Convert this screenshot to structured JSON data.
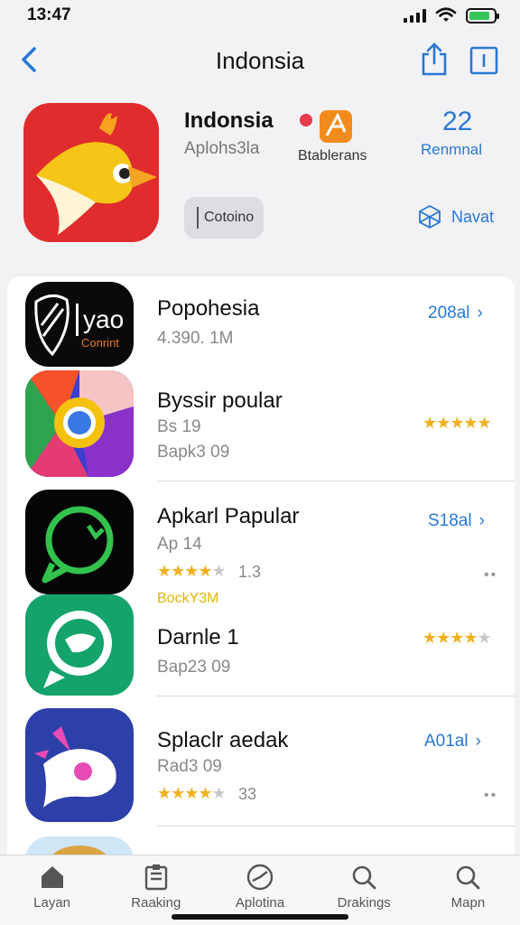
{
  "status": {
    "time": "13:47"
  },
  "nav": {
    "title": "Indonsia"
  },
  "header": {
    "app_name": "Indonsia",
    "app_subtitle": "Aplohs3la",
    "category_label": "Btablerans",
    "rank_number": "22",
    "rank_label": "Renmnal",
    "get_button": "Cotoino",
    "navigate_label": "Navat"
  },
  "list": [
    {
      "title": "Popohesia",
      "sub": "4.390. 1M",
      "action": "208al",
      "logo_text": "yao",
      "logo_sub": "Conrint"
    },
    {
      "title": "Byssir poular",
      "sub": "Bs 19",
      "sub2": "Bapk3 09",
      "stars": 5
    },
    {
      "title": "Apkarl Papular",
      "sub": "Ap 14",
      "rating_count": "1.3",
      "badge": "BockY3M",
      "action": "S18al",
      "stars": 4
    },
    {
      "title": "Darnle 1",
      "sub": "Bap23 09",
      "stars": 4
    },
    {
      "title": "Splaclr aedak",
      "sub": "Rad3 09",
      "rating_count": "33",
      "action": "A01al",
      "stars": 4
    }
  ],
  "tabs": [
    {
      "label": "Layan",
      "icon": "home-icon"
    },
    {
      "label": "Raaking",
      "icon": "ranking-icon"
    },
    {
      "label": "Aplotina",
      "icon": "compass-icon"
    },
    {
      "label": "Drakings",
      "icon": "search-icon"
    },
    {
      "label": "Mapn",
      "icon": "search-icon"
    }
  ],
  "colors": {
    "accent": "#2878d6",
    "star": "#f2b01e",
    "brand_red": "#e02c2c"
  }
}
